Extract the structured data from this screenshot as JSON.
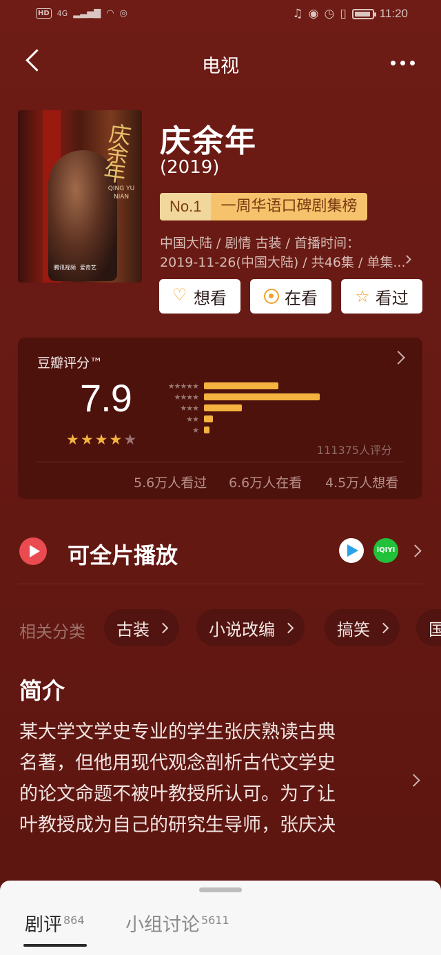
{
  "status_bar": {
    "network": "4G",
    "hd": "HD",
    "time": "11:20",
    "battery_level": 0.9
  },
  "nav": {
    "title": "电视"
  },
  "show": {
    "title": "庆余年",
    "year": "(2019)",
    "rank_no": "No.1",
    "rank_text": "一周华语口碑剧集榜",
    "meta_line_1": "中国大陆 / 剧情 古装 / 首播时间：",
    "meta_line_2": "2019-11-26(中国大陆) / 共46集 / 单集...",
    "poster": {
      "title_text": "庆余年",
      "en_text": "QING YU NIAN",
      "logo_1": "腾讯视频",
      "logo_2": "爱奇艺"
    }
  },
  "actions": {
    "want_label": "想看",
    "watching_label": "在看",
    "watched_label": "看过"
  },
  "rating": {
    "label": "豆瓣评分™",
    "score": "7.9",
    "stars": 4,
    "distribution": [
      {
        "stars": 5,
        "share": 0.43
      },
      {
        "stars": 4,
        "share": 0.67
      },
      {
        "stars": 3,
        "share": 0.22
      },
      {
        "stars": 2,
        "share": 0.05
      },
      {
        "stars": 1,
        "share": 0.03
      }
    ],
    "count_text": "111375人评分",
    "watched_text": "5.6万人看过",
    "watching_text": "6.6万人在看",
    "want_text": "4.5万人想看",
    "colors": {
      "bar": "#f4b340",
      "star_on": "#f4b340",
      "star_off": "#9a7570"
    }
  },
  "play": {
    "label": "可全片播放",
    "platforms": [
      "tencent-video-icon",
      "iqiyi-icon"
    ],
    "iqiyi_text": "iQIYI"
  },
  "categories": {
    "label": "相关分类",
    "items": [
      "古装",
      "小说改编",
      "搞笑",
      "国"
    ]
  },
  "intro": {
    "title": "简介",
    "lines": [
      "某大学文学史专业的学生张庆熟读古典",
      "名著，但他用现代观念剖析古代文学史",
      "的论文命题不被叶教授所认可。为了让",
      "叶教授成为自己的研究生导师，张庆决"
    ]
  },
  "bottom_tabs": [
    {
      "label": "剧评",
      "count": "864"
    },
    {
      "label": "小组讨论",
      "count": "5611"
    }
  ]
}
